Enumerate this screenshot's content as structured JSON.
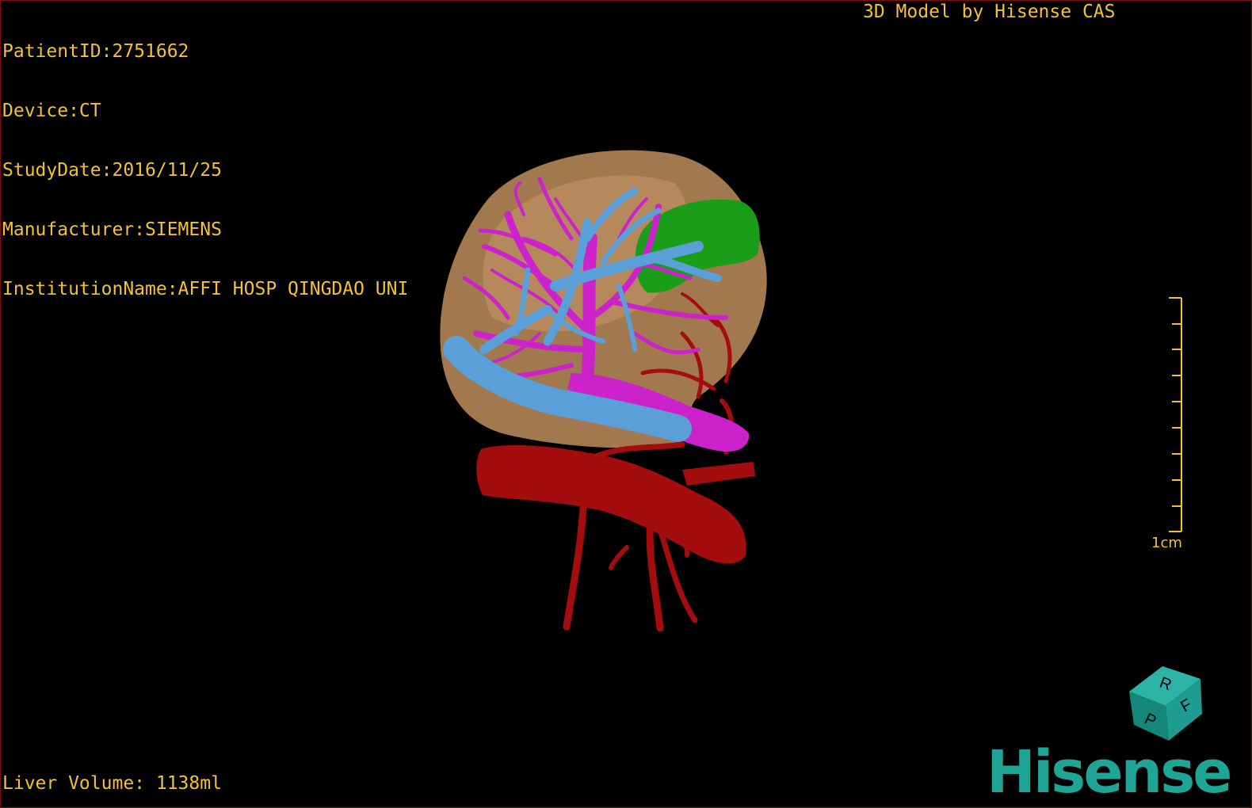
{
  "overlay": {
    "patient_id": "PatientID:2751662",
    "device": "Device:CT",
    "study_date": "StudyDate:2016/11/25",
    "manufacturer": "Manufacturer:SIEMENS",
    "institution": "InstitutionName:AFFI HOSP QINGDAO UNI",
    "credit": "3D Model by Hisense CAS",
    "liver_volume": "Liver Volume: 1138ml"
  },
  "scale_bar": {
    "label": "1cm"
  },
  "orientation_cube": {
    "labels": [
      "R",
      "F",
      "P"
    ]
  },
  "brand": {
    "logo_text": "Hisense"
  },
  "colors": {
    "text": "#f2c230",
    "liver": "#b8895a",
    "portal_vein": "#cc22cc",
    "hepatic_vein": "#5b9fd8",
    "artery": "#a30d0d",
    "gallbladder": "#1a9e1a",
    "brand": "#1fa596",
    "border": "#7a1010"
  }
}
